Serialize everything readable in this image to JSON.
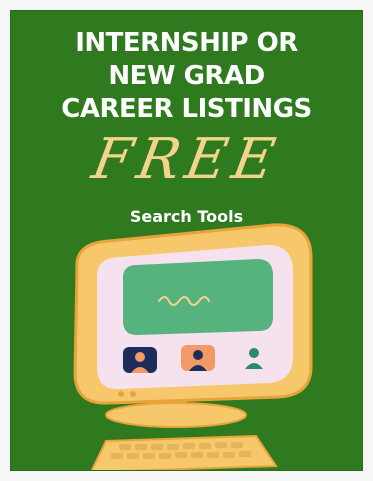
{
  "poster": {
    "title_lines": [
      "INTERNSHIP OR",
      "NEW GRAD",
      "CAREER LISTINGS"
    ],
    "free_label": "FREE",
    "subtitle": "Search Tools"
  },
  "colors": {
    "background": "#2f7a1f",
    "accent": "#f2d58b",
    "monitor": "#f7c76c",
    "screen": "#f6e2ef",
    "banner": "#56b37d",
    "avatar_navy": "#1d2d5b",
    "avatar_orange": "#f29a67",
    "avatar_teal": "#2a8a6a"
  },
  "icons": [
    "monitor-icon",
    "keyboard-icon",
    "user-avatar-icon"
  ]
}
